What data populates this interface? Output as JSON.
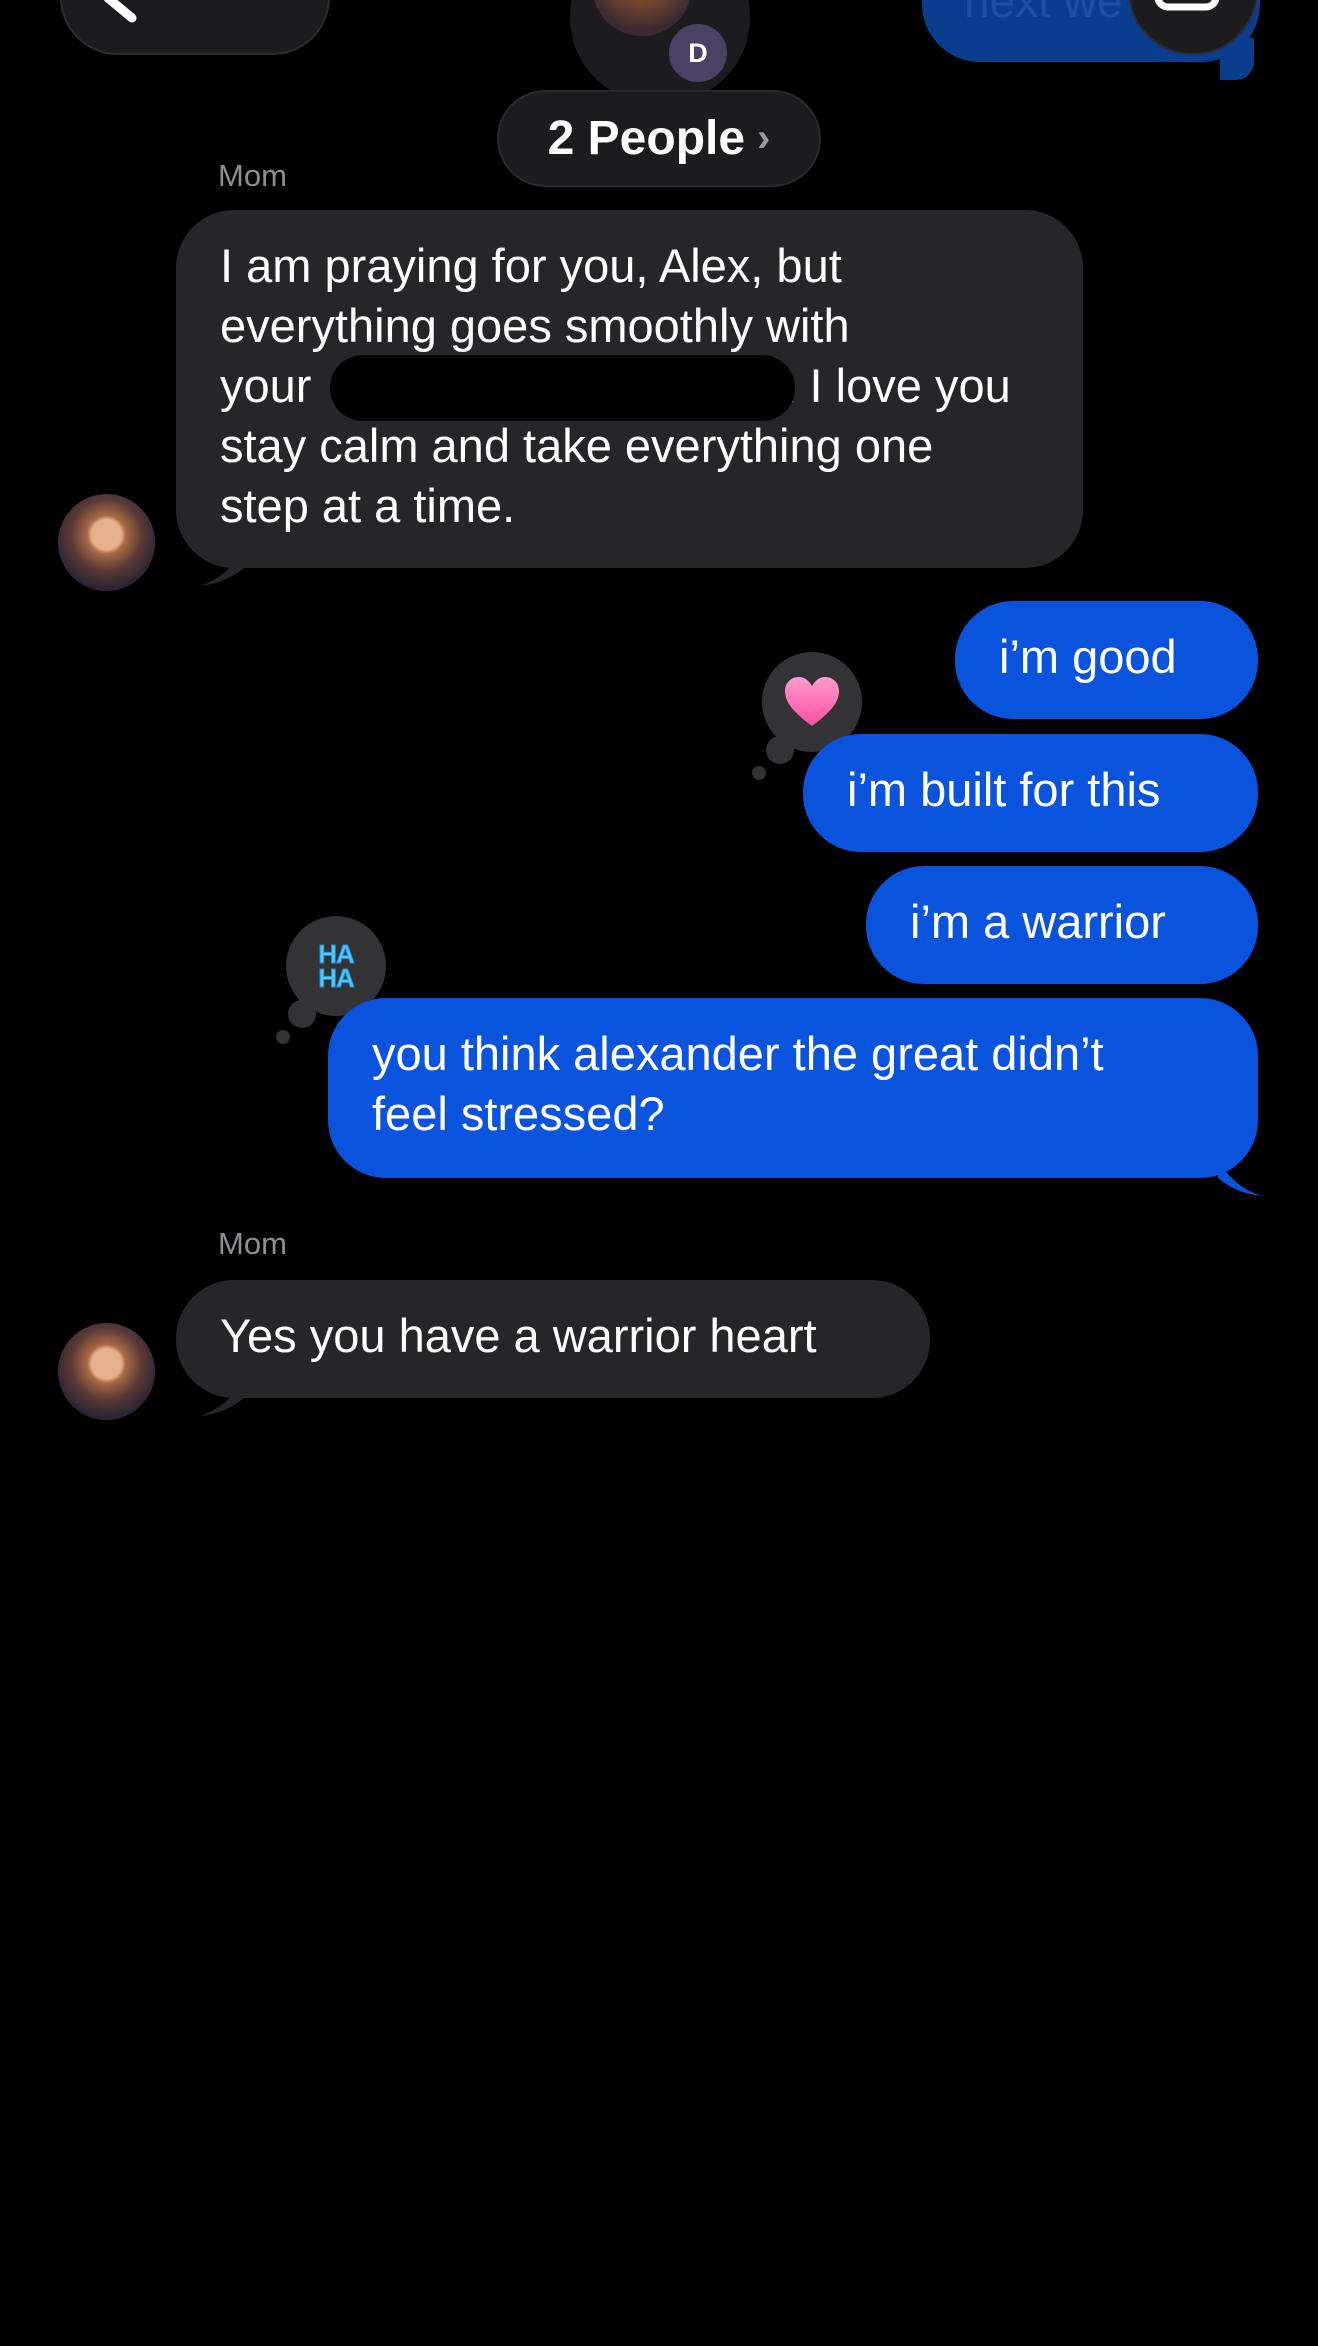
{
  "header": {
    "contact_badge": "D",
    "people_label": "2 People",
    "people_chevron": "›",
    "top_bubble_text": "next we"
  },
  "messages": [
    {
      "sender": "Mom",
      "direction": "incoming",
      "lines": [
        "I am praying for you, Alex, but",
        "everything goes smoothly with",
        "your",
        ". I love you",
        "stay calm and take everything one",
        "step at a time."
      ]
    },
    {
      "direction": "outgoing",
      "text": "i’m good"
    },
    {
      "direction": "outgoing",
      "text": "i’m built for this",
      "reaction": "heart-reaction"
    },
    {
      "direction": "outgoing",
      "text": "i’m a warrior"
    },
    {
      "direction": "outgoing",
      "lines": [
        "you think alexander the great didn’t",
        "feel stressed?"
      ],
      "reaction": "haha-reaction",
      "reaction_text": [
        "HA",
        "HA"
      ]
    },
    {
      "sender": "Mom",
      "direction": "incoming",
      "text": "Yes you have a warrior heart"
    }
  ],
  "colors": {
    "background": "#000000",
    "incoming_bubble": "#262628",
    "outgoing_bubble": "#0a53dd",
    "sender_label": "#8e8e93",
    "heart": "#ff6fb5",
    "haha": "#56c7f5"
  }
}
